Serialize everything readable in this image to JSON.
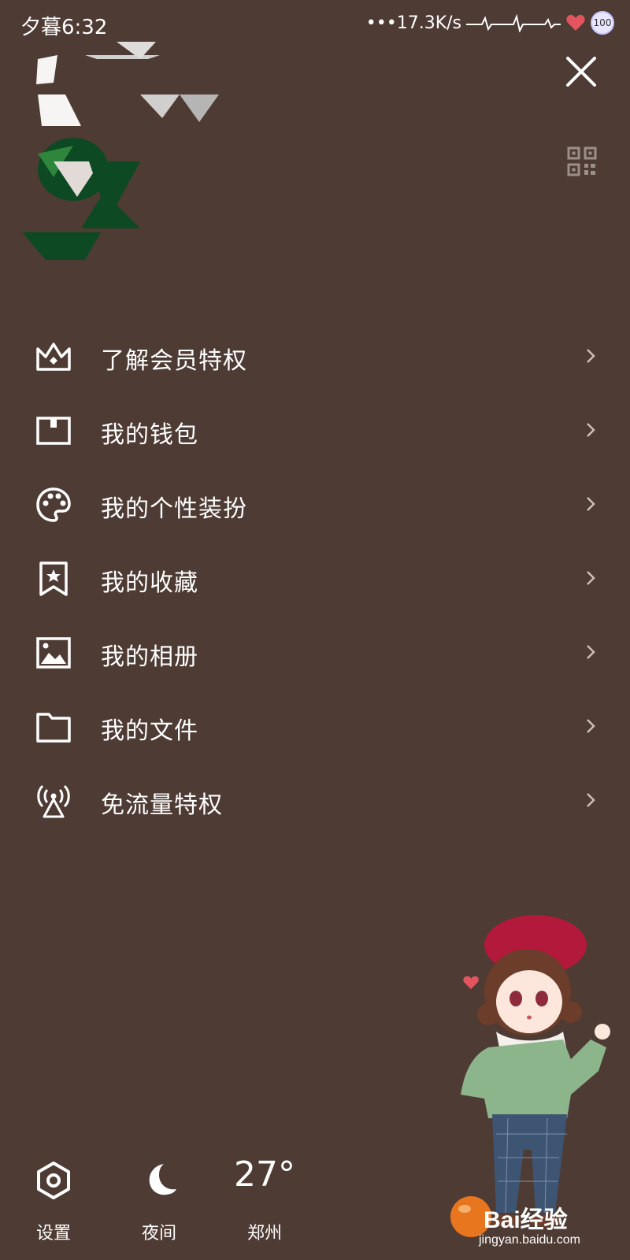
{
  "status_bar": {
    "time": "夕暮6:32",
    "network": "•••17.3K/s",
    "battery": "100"
  },
  "header": {
    "close_icon": "close-icon",
    "qr_icon": "qr-code-icon"
  },
  "menu": {
    "items": [
      {
        "label": "了解会员特权",
        "icon": "crown-icon"
      },
      {
        "label": "我的钱包",
        "icon": "wallet-icon"
      },
      {
        "label": "我的个性装扮",
        "icon": "palette-icon"
      },
      {
        "label": "我的收藏",
        "icon": "bookmark-star-icon"
      },
      {
        "label": "我的相册",
        "icon": "image-icon"
      },
      {
        "label": "我的文件",
        "icon": "folder-icon"
      },
      {
        "label": "免流量特权",
        "icon": "antenna-icon"
      }
    ]
  },
  "bottom": {
    "settings_label": "设置",
    "night_label": "夜间",
    "temperature": "27°",
    "city": "郑州"
  },
  "watermark": {
    "brand": "Bai经验",
    "cn": "",
    "url": "jingyan.baidu.com"
  },
  "colors": {
    "background": "#4e3b34",
    "foreground": "#ffffff",
    "accent_red": "#b3193a",
    "accent_green": "#0a4a22"
  }
}
